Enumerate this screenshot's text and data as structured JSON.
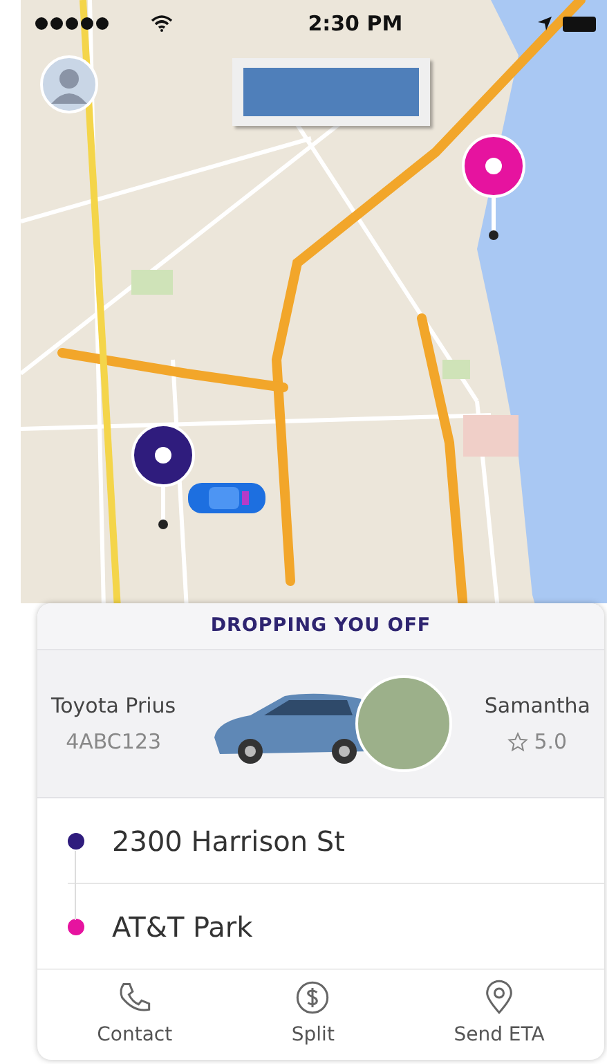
{
  "status_bar": {
    "time": "2:30 PM"
  },
  "map": {
    "redaction": true
  },
  "panel": {
    "header": "DROPPING YOU OFF",
    "vehicle": {
      "model": "Toyota Prius",
      "plate": "4ABC123"
    },
    "driver": {
      "name": "Samantha",
      "rating": "5.0"
    },
    "stops": [
      {
        "address": "2300 Harrison St",
        "color": "#2f1c7d"
      },
      {
        "address": "AT&T Park",
        "color": "#e6139f"
      }
    ],
    "actions": [
      {
        "label": "Contact",
        "kind": "phone"
      },
      {
        "label": "Split",
        "kind": "dollar"
      },
      {
        "label": "Send ETA",
        "kind": "pin"
      }
    ]
  }
}
